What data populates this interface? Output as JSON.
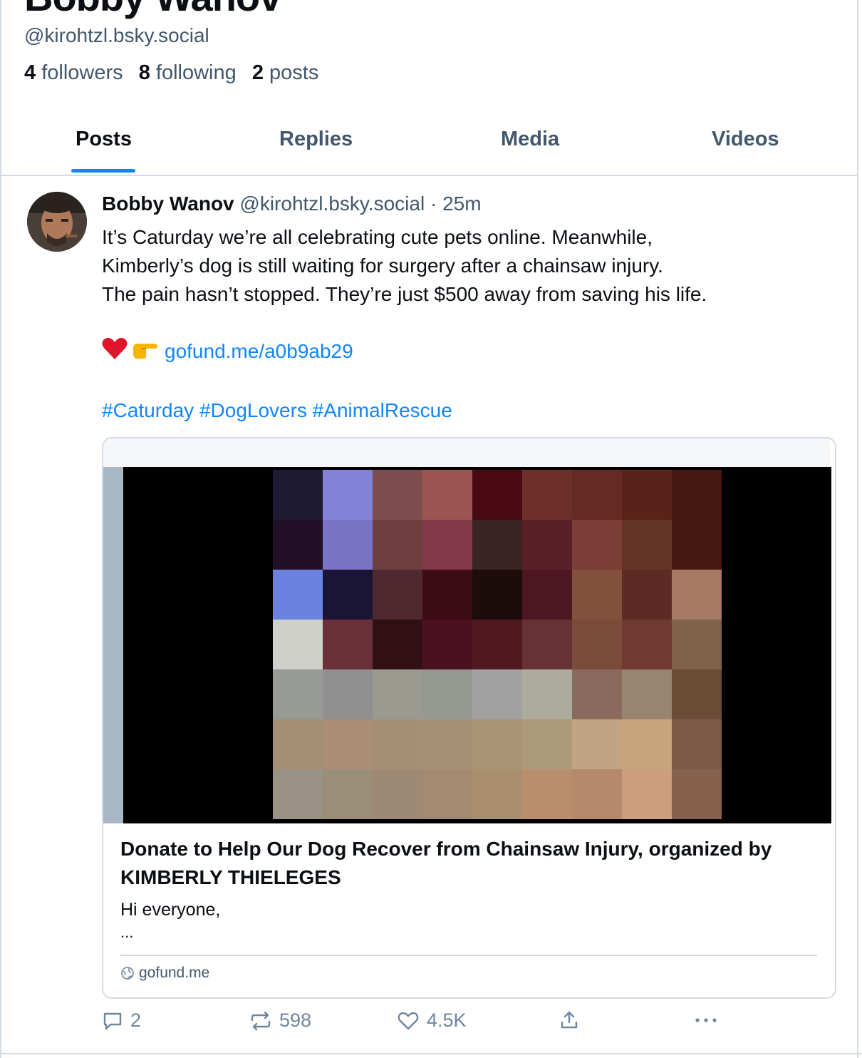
{
  "profile": {
    "display_name": "Bobby Wanov",
    "handle": "@kirohtzl.bsky.social",
    "followers_count": "4",
    "followers_label": "followers",
    "following_count": "8",
    "following_label": "following",
    "posts_count": "2",
    "posts_label": "posts"
  },
  "tabs": [
    {
      "label": "Posts",
      "active": true
    },
    {
      "label": "Replies",
      "active": false
    },
    {
      "label": "Media",
      "active": false
    },
    {
      "label": "Videos",
      "active": false
    }
  ],
  "post": {
    "author": "Bobby Wanov",
    "handle": "@kirohtzl.bsky.social",
    "separator": "·",
    "time": "25m",
    "lines": [
      "It’s Caturday we’re all celebrating cute pets online. Meanwhile,",
      "Kimberly’s dog is still waiting for surgery after a chainsaw injury.",
      "The pain hasn’t stopped. They’re just $500 away from saving his life."
    ],
    "link": "gofund.me/a0b9ab29",
    "hashtags": "#Caturday #DogLovers #AnimalRescue",
    "card": {
      "title": "Donate to Help Our Dog Recover from Chainsaw Injury, organized by KIMBERLY THIELEGES",
      "description": "Hi everyone,",
      "ellipsis": "...",
      "domain": "gofund.me"
    },
    "actions": {
      "replies": "2",
      "reposts": "598",
      "likes": "4.5K"
    }
  },
  "colors": {
    "accent": "#1185fe",
    "muted": "#42576c",
    "border": "#d4dbe2"
  }
}
